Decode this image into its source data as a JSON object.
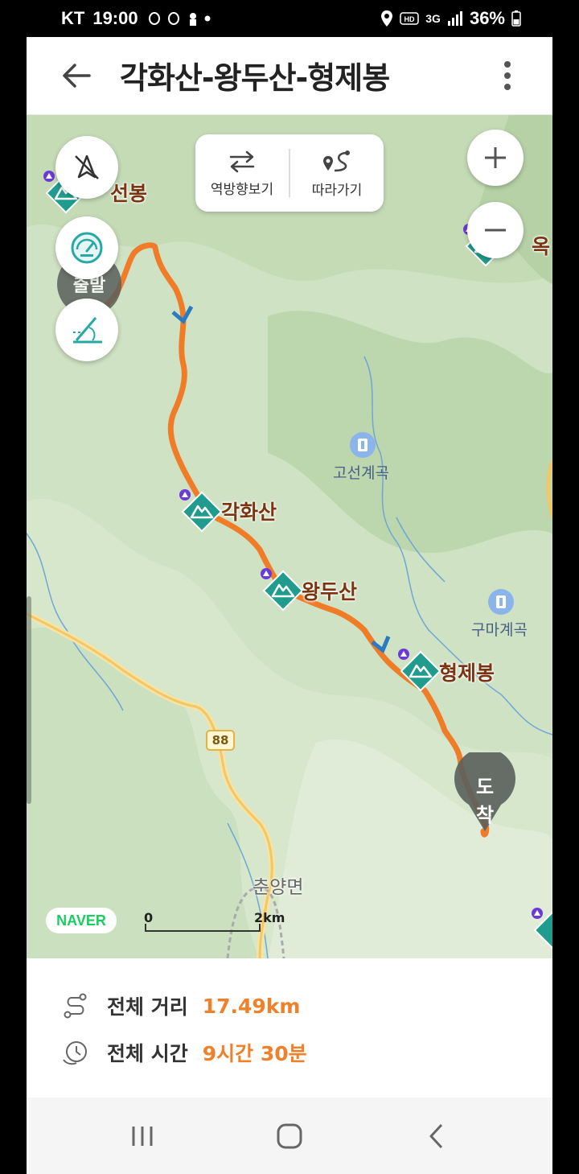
{
  "status_bar": {
    "carrier": "KT",
    "time": "19:00",
    "network": "3G",
    "battery": "36%"
  },
  "header": {
    "title": "각화산-왕두산-형제봉"
  },
  "map_controls": {
    "reverse_label": "역방향보기",
    "follow_label": "따라가기"
  },
  "map": {
    "peaks": [
      {
        "name": "각화산"
      },
      {
        "name": "왕두산"
      },
      {
        "name": "형제봉"
      }
    ],
    "partial_peaks": [
      "선봉",
      "옥"
    ],
    "pois": [
      "고선계곡",
      "구마계곡"
    ],
    "route_start": "출발",
    "route_end": "도착",
    "road_number": "88",
    "town": "춘양면",
    "scale": {
      "zero": "0",
      "distance": "2km"
    },
    "brand": "NAVER",
    "route_color": "#f07c28"
  },
  "summary": {
    "distance_label": "전체 거리",
    "distance_value": "17.49km",
    "time_label": "전체 시간",
    "time_value": "9시간 30분"
  },
  "nav_bar": {
    "icons": [
      "recent-apps-icon",
      "home-icon",
      "back-icon"
    ]
  }
}
